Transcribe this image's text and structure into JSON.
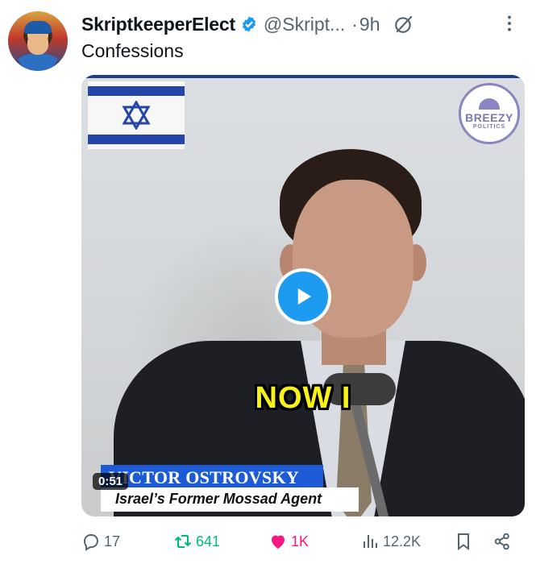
{
  "author": {
    "display_name": "SkriptkeeperElect",
    "handle": "@Skript...",
    "separator": "·",
    "time": "9h",
    "verified": true
  },
  "tweet": {
    "text": "Confessions"
  },
  "media": {
    "duration": "0:51",
    "overlay_caption": "NOW I",
    "lower_third_name": "VICTOR OSTROVSKY",
    "lower_third_title": "Israel’s Former Mossad Agent",
    "watermark_line1": "BREEZY",
    "watermark_line2": "POLITICS"
  },
  "actions": {
    "replies": "17",
    "retweets": "641",
    "likes": "1K",
    "views": "12.2K"
  },
  "colors": {
    "accent": "#1d9bf0",
    "retweet": "#00ba7c",
    "like": "#f91880",
    "muted": "#536471",
    "caption_yellow": "#f7f21a"
  }
}
